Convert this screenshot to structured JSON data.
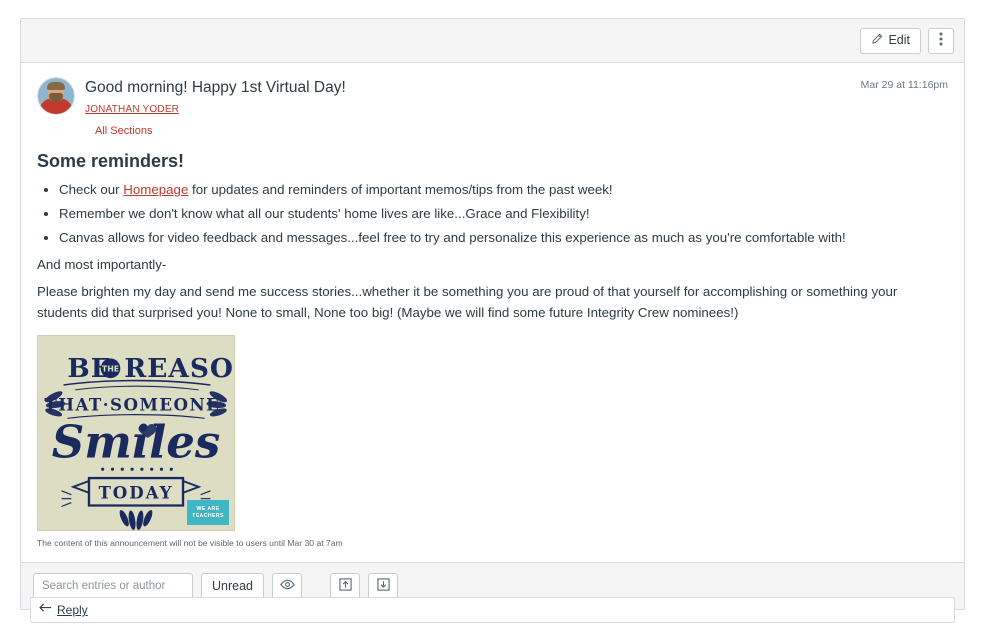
{
  "toolbar": {
    "edit_label": "Edit",
    "edit_icon": "pencil-icon",
    "menu_icon": "kebab-menu-icon"
  },
  "announcement": {
    "title": "Good morning! Happy 1st Virtual Day!",
    "author": "JONATHAN YODER",
    "sections": "All Sections",
    "posted_at": "Mar 29 at 11:16pm",
    "avatar_alt": "avatar",
    "heading": "Some reminders!",
    "bullets": [
      {
        "before": "Check our ",
        "link": "Homepage",
        "after": " for updates and reminders of important memos/tips from the past week!"
      },
      {
        "before": "Remember we don't know what all our students' home lives are like...Grace and Flexibility!",
        "link": "",
        "after": ""
      },
      {
        "before": "Canvas allows for video feedback and messages...feel free to try and personalize this experience as much as you're comfortable with!",
        "link": "",
        "after": ""
      }
    ],
    "paragraph_1": "And most importantly-",
    "paragraph_2": "Please brighten my day and send me success stories...whether it be something you are proud of that yourself for accomplishing or something your students did that surprised you! None to small, None too big! (Maybe we will find some future Integrity Crew nominees!)",
    "poster": {
      "line1": "BE",
      "line1b": "THE",
      "line1c": "REASON",
      "line2": "THAT · SOMEONE ·",
      "line3": "Smiles",
      "line4": "TODAY",
      "logo_line1": "WE ARE",
      "logo_line2": "TEACHERS",
      "bg_color": "#ddddc4",
      "ink_color": "#1b2a5e"
    },
    "visibility_note": "The content of this announcement will not be visible to users until Mar 30 at 7am"
  },
  "filterbar": {
    "search_placeholder": "Search entries or author",
    "search_value": "",
    "unread_label": "Unread",
    "eye_icon": "eye-icon",
    "collapse_icon": "collapse-threads-icon",
    "expand_icon": "expand-threads-icon"
  },
  "reply": {
    "label": "Reply",
    "icon": "reply-arrow-icon"
  },
  "colors": {
    "link": "#c0392b",
    "text": "#2d3b45",
    "border": "#d5dbe0",
    "band": "#f5f5f5"
  }
}
